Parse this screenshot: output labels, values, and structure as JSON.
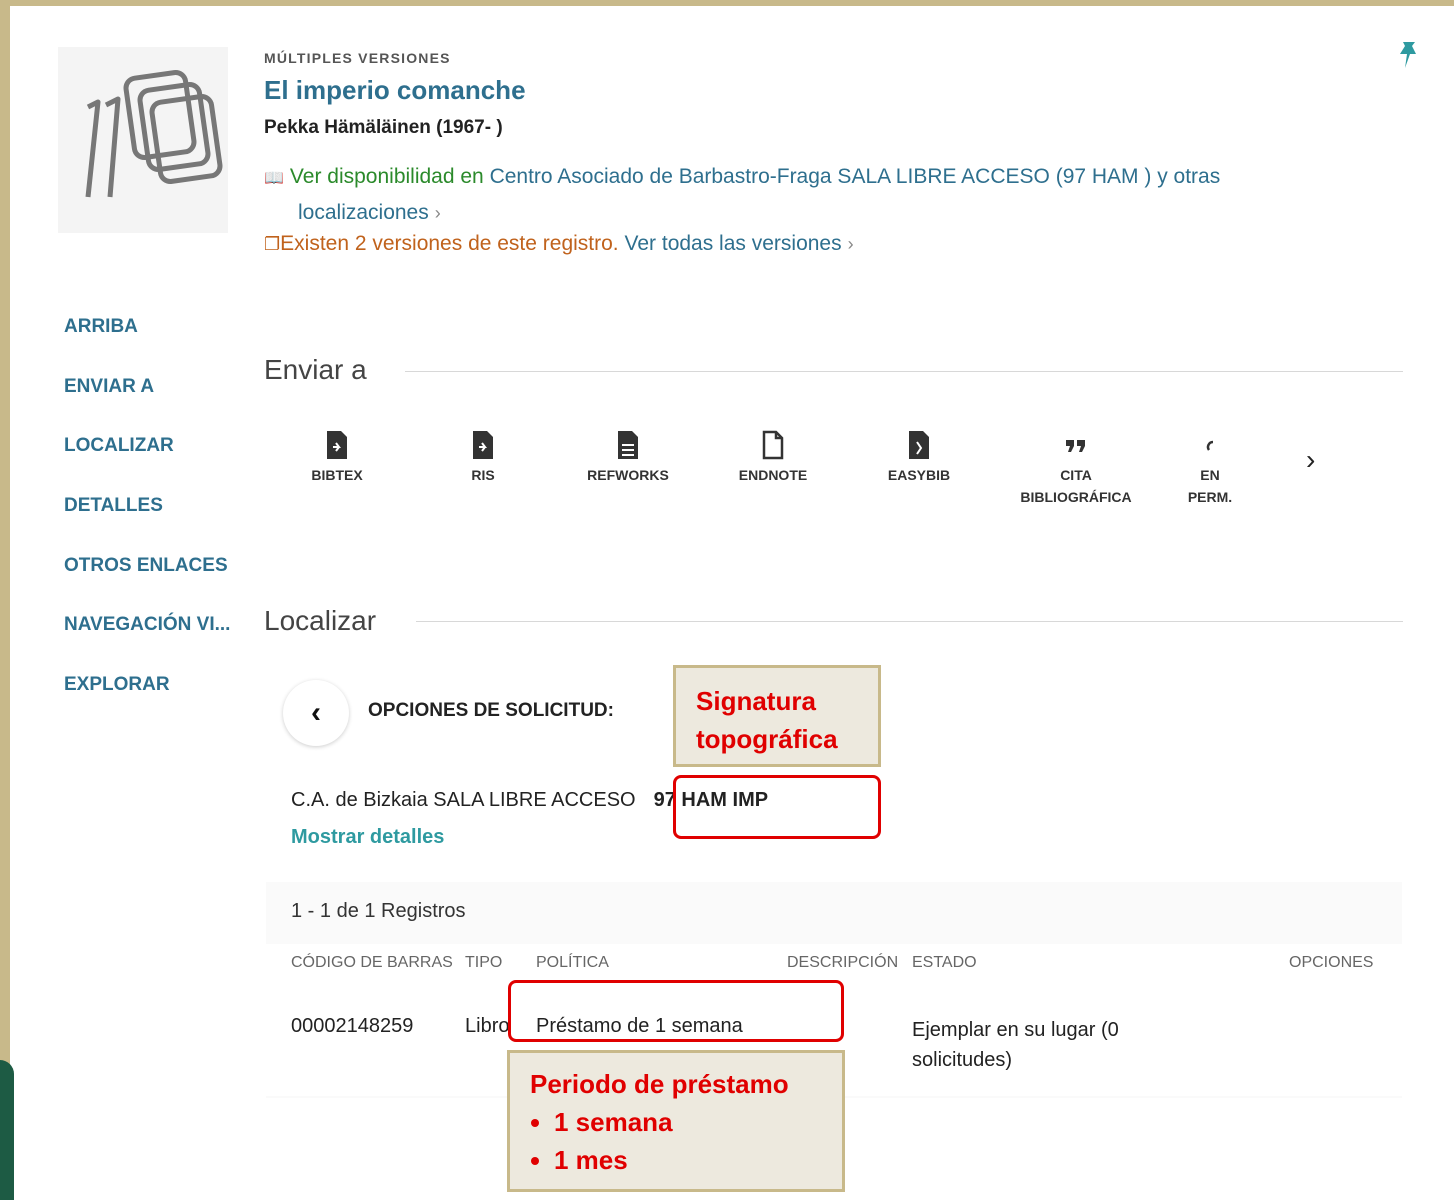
{
  "record": {
    "overline": "MÚLTIPLES VERSIONES",
    "title": "El imperio comanche",
    "author": "Pekka Hämäläinen (1967- )",
    "availability": {
      "prefix": "Ver disponibilidad en",
      "location": "Centro Asociado de Barbastro-Fraga  SALA LIBRE ACCESO (97 HAM ) y otras",
      "more": "localizaciones"
    },
    "versions": {
      "text": "Existen 2 versiones de este registro.",
      "link": "Ver todas las versiones"
    }
  },
  "nav": [
    "ARRIBA",
    "ENVIAR A",
    "LOCALIZAR",
    "DETALLES",
    "OTROS ENLACES",
    "NAVEGACIÓN VI...",
    "EXPLORAR"
  ],
  "send_to": {
    "title": "Enviar a",
    "items": [
      "BIBTEX",
      "RIS",
      "REFWORKS",
      "ENDNOTE",
      "EASYBIB",
      "CITA BIBLIOGRÁFICA",
      "EN PERM."
    ]
  },
  "locate": {
    "title": "Localizar",
    "request_options": "OPCIONES DE SOLICITUD:",
    "location_name": "C.A. de Bizkaia  SALA LIBRE ACCESO",
    "call_number": "97 HAM IMP",
    "show_details": "Mostrar detalles",
    "records_count": "1 - 1 de 1 Registros",
    "columns": [
      "CÓDIGO DE BARRAS",
      "TIPO",
      "POLÍTICA",
      "DESCRIPCIÓN",
      "ESTADO",
      "OPCIONES"
    ],
    "row": {
      "barcode": "00002148259",
      "type": "Libro",
      "policy": "Préstamo de 1 semana",
      "status": "Ejemplar en su lugar (0 solicitudes)"
    }
  },
  "annotations": {
    "signature": "Signatura topográfica",
    "loan_period": "Periodo de préstamo",
    "loan_options": [
      "1 semana",
      "1 mes"
    ]
  }
}
